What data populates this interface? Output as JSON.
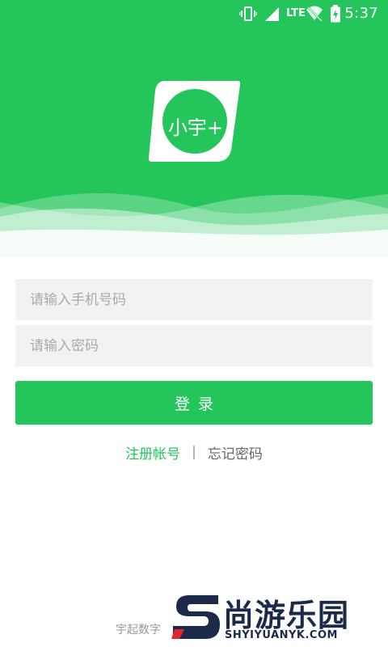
{
  "status_bar": {
    "network": "LTE",
    "time": "5:37",
    "icons": [
      "vibrate-icon",
      "signal-icon",
      "wifi-off-icon",
      "battery-charging-icon"
    ]
  },
  "logo": {
    "text": "小宇+"
  },
  "form": {
    "phone_placeholder": "请输入手机号码",
    "phone_value": "",
    "password_placeholder": "请输入密码",
    "password_value": "",
    "login_label": "登录"
  },
  "links": {
    "register": "注册帐号",
    "separator": "|",
    "forgot": "忘记密码"
  },
  "footer": {
    "text": "宇起数字"
  },
  "watermark": {
    "cn": "尚游乐园",
    "en": "SHYIYUANYK.COM"
  },
  "colors": {
    "brand": "#24c65b",
    "input_bg": "#f2f2f2",
    "link_muted": "#666666"
  }
}
